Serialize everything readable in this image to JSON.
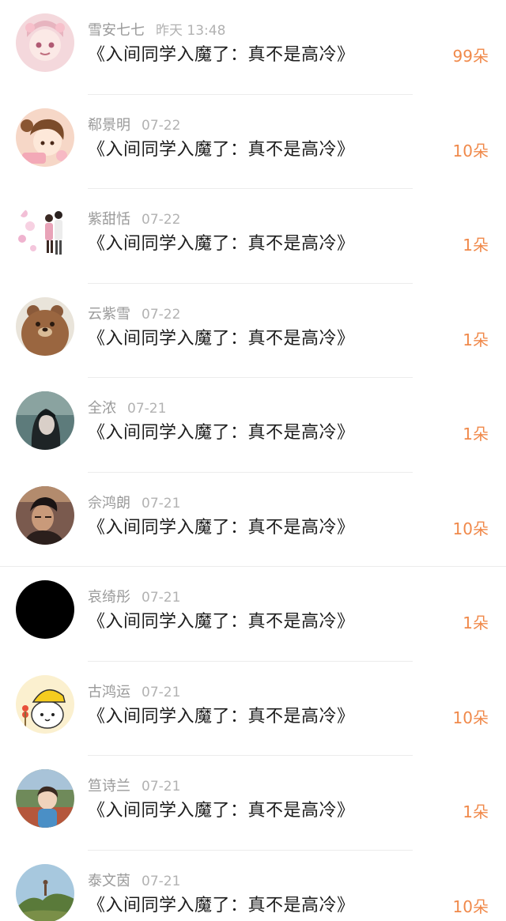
{
  "rows": [
    {
      "name": "雪安七七",
      "time": "昨天 13:48",
      "title": "《入间同学入魔了：真不是高冷》",
      "gift": "99朵",
      "avatar": "pink-anime-girl-icon"
    },
    {
      "name": "郗景明",
      "time": "07-22",
      "title": "《入间同学入魔了：真不是高冷》",
      "gift": "10朵",
      "avatar": "cartoon-girl-icon"
    },
    {
      "name": "紫甜恬",
      "time": "07-22",
      "title": "《入间同学入魔了：真不是高冷》",
      "gift": "1朵",
      "avatar": "couple-illustration-icon"
    },
    {
      "name": "云紫雪",
      "time": "07-22",
      "title": "《入间同学入魔了：真不是高冷》",
      "gift": "1朵",
      "avatar": "brown-bear-icon"
    },
    {
      "name": "全浓",
      "time": "07-21",
      "title": "《入间同学入魔了：真不是高冷》",
      "gift": "1朵",
      "avatar": "dark-girl-photo-icon"
    },
    {
      "name": "佘鸿朗",
      "time": "07-21",
      "title": "《入间同学入魔了：真不是高冷》",
      "gift": "10朵",
      "avatar": "man-portrait-icon"
    },
    {
      "name": "哀绮彤",
      "time": "07-21",
      "title": "《入间同学入魔了：真不是高冷》",
      "gift": "1朵",
      "avatar": "black-circle-icon"
    },
    {
      "name": "古鸿运",
      "time": "07-21",
      "title": "《入间同学入魔了：真不是高冷》",
      "gift": "10朵",
      "avatar": "yellow-hat-cat-icon"
    },
    {
      "name": "笪诗兰",
      "time": "07-21",
      "title": "《入间同学入魔了：真不是高冷》",
      "gift": "1朵",
      "avatar": "child-photo-icon"
    },
    {
      "name": "泰文茵",
      "time": "07-21",
      "title": "《入间同学入魔了：真不是高冷》",
      "gift": "10朵",
      "avatar": "landscape-photo-icon"
    }
  ]
}
